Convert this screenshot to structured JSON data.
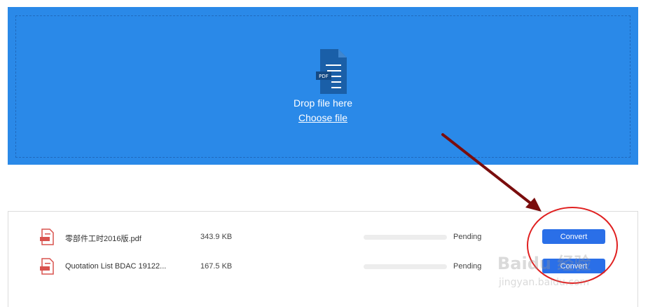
{
  "dropzone": {
    "drop_text": "Drop file here",
    "choose_text": "Choose file",
    "icon_badge": "PDF",
    "bg_color": "#2a89e8"
  },
  "files": [
    {
      "name": "零部件工时2016版.pdf",
      "size": "343.9 KB",
      "status": "Pending",
      "button": "Convert",
      "progress": 0,
      "icon": "pdf-file-icon"
    },
    {
      "name": "Quotation List BDAC 19122...",
      "size": "167.5 KB",
      "status": "Pending",
      "button": "Convert",
      "progress": 0,
      "icon": "pdf-file-icon"
    }
  ],
  "watermark": {
    "main": "Baidu 经验",
    "sub": "jingyan.baidu.com"
  },
  "annotation_color": "#e02020",
  "arrow_color": "#7a0d0d"
}
